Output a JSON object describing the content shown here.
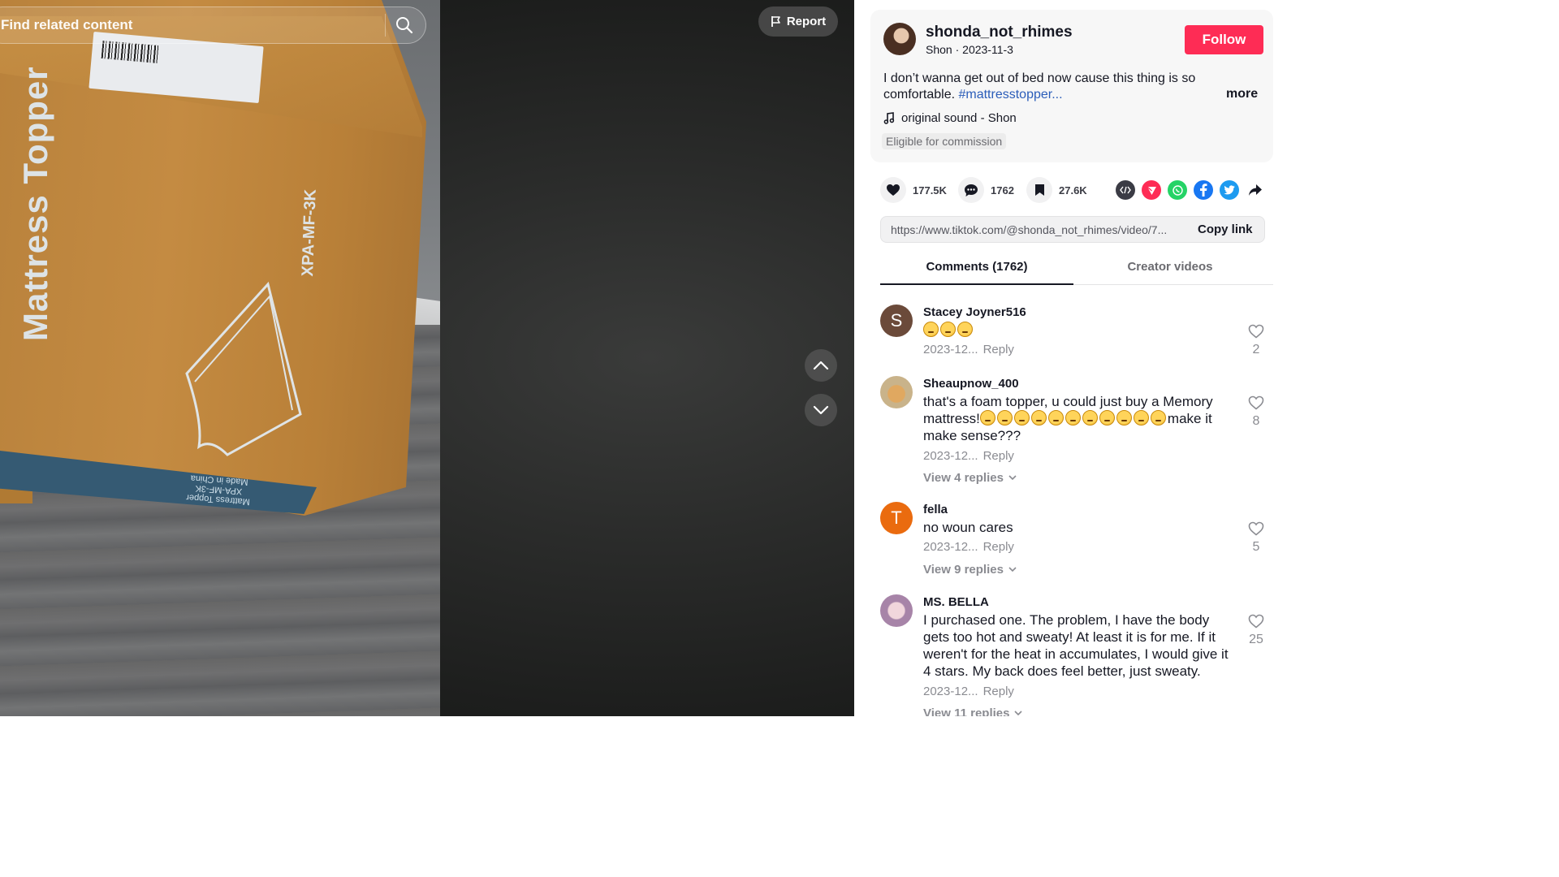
{
  "search": {
    "placeholder": "Find related content"
  },
  "video": {
    "box_text_main": "Mattress Topper",
    "box_text_model": "XPA-MF-3K",
    "box_text_bottom": [
      "Mattress Topper",
      "XPA-MF-3K",
      "Made in China"
    ],
    "report_label": "Report"
  },
  "author": {
    "username": "shonda_not_rhimes",
    "nickname": "Shon",
    "date": "2023-11-3",
    "follow_label": "Follow"
  },
  "caption": {
    "text": "I don’t wanna get out of bed now cause this thing is so comfortable. ",
    "hashtag": "#mattresstopper...",
    "more_label": "more"
  },
  "music": {
    "label": "original sound - Shon"
  },
  "commission_badge": "Eligible for commission",
  "actions": {
    "likes": "177.5K",
    "comments": "1762",
    "saves": "27.6K",
    "share_icons": [
      "embed-icon",
      "send-icon",
      "whatsapp-icon",
      "facebook-icon",
      "twitter-icon",
      "share-arrow-icon"
    ]
  },
  "link": {
    "url": "https://www.tiktok.com/@shonda_not_rhimes/video/7...",
    "copy_label": "Copy link"
  },
  "tabs": {
    "comments_label": "Comments (1762)",
    "creator_label": "Creator videos"
  },
  "comments": [
    {
      "initial": "S",
      "avatar_color": "#6b4a3a",
      "user": "Stacey Joyner516",
      "text": "",
      "emoji_count": 3,
      "date": "2023-12...",
      "reply": "Reply",
      "likes": "2",
      "replies": ""
    },
    {
      "initial": "",
      "avatar_color": "#c9b38a",
      "user": "Sheaupnow_400",
      "text_before": "that's a foam topper, u could just buy a Memory mattress!",
      "emoji_count": 11,
      "text_after": "make it make sense???",
      "date": "2023-12...",
      "reply": "Reply",
      "likes": "8",
      "replies": "View 4 replies"
    },
    {
      "initial": "T",
      "avatar_color": "#ea6b0f",
      "user": "fella",
      "text": "no woun cares",
      "date": "2023-12...",
      "reply": "Reply",
      "likes": "5",
      "replies": "View 9 replies"
    },
    {
      "initial": "",
      "avatar_color": "#b79ab5",
      "user": "MS. BELLA",
      "text": "I purchased one. The problem, I have the body gets too hot and sweaty! At least it is for me. If it weren't for the heat in accumulates, I would give it 4 stars. My back does feel better, just sweaty.",
      "date": "2023-12...",
      "reply": "Reply",
      "likes": "25",
      "replies": "View 11 replies"
    }
  ],
  "colors": {
    "follow": "#fe2c55",
    "hashtag": "#2b5db9",
    "whatsapp": "#25d366",
    "facebook": "#1877f2",
    "twitter": "#1d9bf0",
    "send": "#fe2c55"
  }
}
